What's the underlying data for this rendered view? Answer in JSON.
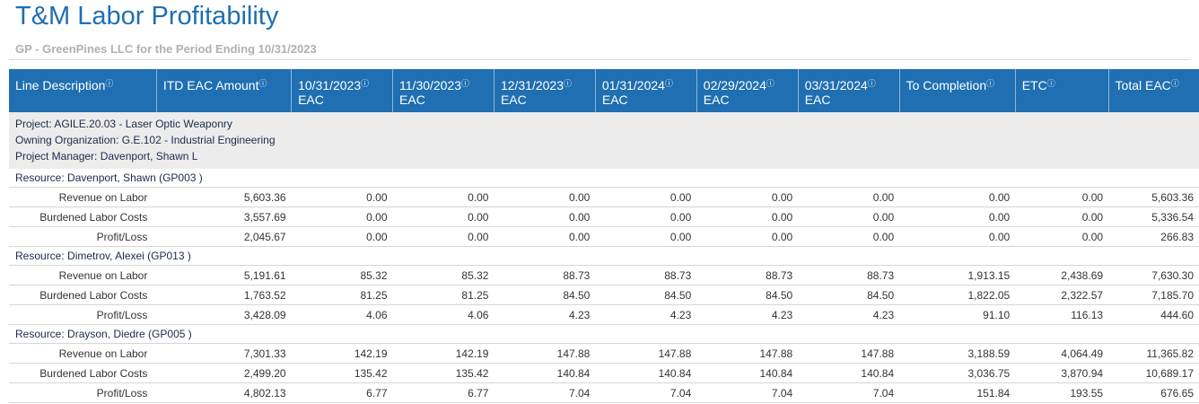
{
  "title": "T&M Labor Profitability",
  "subtitle": "GP - GreenPines LLC for the Period Ending 10/31/2023",
  "columns": [
    {
      "line1": "Line Description",
      "line2": ""
    },
    {
      "line1": "ITD EAC Amount",
      "line2": ""
    },
    {
      "line1": "10/31/2023",
      "line2": "EAC"
    },
    {
      "line1": "11/30/2023",
      "line2": "EAC"
    },
    {
      "line1": "12/31/2023",
      "line2": "EAC"
    },
    {
      "line1": "01/31/2024",
      "line2": "EAC"
    },
    {
      "line1": "02/29/2024",
      "line2": "EAC"
    },
    {
      "line1": "03/31/2024",
      "line2": "EAC"
    },
    {
      "line1": "To Completion",
      "line2": ""
    },
    {
      "line1": "ETC",
      "line2": ""
    },
    {
      "line1": "Total EAC",
      "line2": ""
    }
  ],
  "info_glyph": "ⓘ",
  "project": {
    "line1": "Project:  AGILE.20.03 -  Laser Optic Weaponry",
    "line2": "Owning Organization: G.E.102 - Industrial Engineering",
    "line3": "Project Manager:  Davenport, Shawn L"
  },
  "resources": [
    {
      "label": "Resource:  Davenport, Shawn (GP003 )",
      "rows": [
        {
          "name": "Revenue on Labor",
          "values": [
            "5,603.36",
            "0.00",
            "0.00",
            "0.00",
            "0.00",
            "0.00",
            "0.00",
            "0.00",
            "0.00",
            "5,603.36"
          ]
        },
        {
          "name": "Burdened Labor Costs",
          "values": [
            "3,557.69",
            "0.00",
            "0.00",
            "0.00",
            "0.00",
            "0.00",
            "0.00",
            "0.00",
            "0.00",
            "5,336.54"
          ]
        },
        {
          "name": "Profit/Loss",
          "values": [
            "2,045.67",
            "0.00",
            "0.00",
            "0.00",
            "0.00",
            "0.00",
            "0.00",
            "0.00",
            "0.00",
            "266.83"
          ]
        }
      ]
    },
    {
      "label": "Resource:  Dimetrov, Alexei (GP013 )",
      "rows": [
        {
          "name": "Revenue on Labor",
          "values": [
            "5,191.61",
            "85.32",
            "85.32",
            "88.73",
            "88.73",
            "88.73",
            "88.73",
            "1,913.15",
            "2,438.69",
            "7,630.30"
          ]
        },
        {
          "name": "Burdened Labor Costs",
          "values": [
            "1,763.52",
            "81.25",
            "81.25",
            "84.50",
            "84.50",
            "84.50",
            "84.50",
            "1,822.05",
            "2,322.57",
            "7,185.70"
          ]
        },
        {
          "name": "Profit/Loss",
          "values": [
            "3,428.09",
            "4.06",
            "4.06",
            "4.23",
            "4.23",
            "4.23",
            "4.23",
            "91.10",
            "116.13",
            "444.60"
          ]
        }
      ]
    },
    {
      "label": "Resource:  Drayson, Diedre (GP005 )",
      "rows": [
        {
          "name": "Revenue on Labor",
          "values": [
            "7,301.33",
            "142.19",
            "142.19",
            "147.88",
            "147.88",
            "147.88",
            "147.88",
            "3,188.59",
            "4,064.49",
            "11,365.82"
          ]
        },
        {
          "name": "Burdened Labor Costs",
          "values": [
            "2,499.20",
            "135.42",
            "135.42",
            "140.84",
            "140.84",
            "140.84",
            "140.84",
            "3,036.75",
            "3,870.94",
            "10,689.17"
          ]
        },
        {
          "name": "Profit/Loss",
          "values": [
            "4,802.13",
            "6.77",
            "6.77",
            "7.04",
            "7.04",
            "7.04",
            "7.04",
            "151.84",
            "193.55",
            "676.65"
          ]
        }
      ]
    }
  ]
}
